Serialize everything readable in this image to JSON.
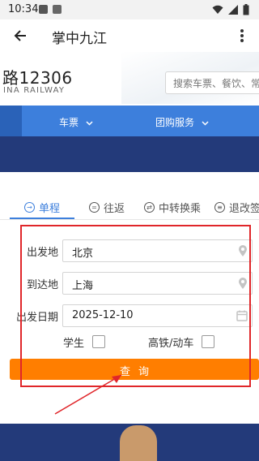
{
  "status_bar": {
    "time": "10:34",
    "icons": [
      "image-notification-icon",
      "text-notification-icon",
      "wifi-icon",
      "signal-icon",
      "battery-icon"
    ]
  },
  "app_bar": {
    "title": "掌中九江",
    "back_icon": "back-arrow-icon",
    "menu_icon": "overflow-menu-icon"
  },
  "site_header": {
    "logo_text": "路12306",
    "logo_subtext": "INA RAILWAY",
    "search_placeholder": "搜索车票、餐饮、常"
  },
  "nav": {
    "items": [
      {
        "label": "车票",
        "icon": "chevron-down-icon"
      },
      {
        "label": "团购服务",
        "icon": "chevron-down-icon"
      }
    ]
  },
  "tabs": [
    {
      "label": "单程",
      "active": true,
      "icon": "arrow-circle-icon"
    },
    {
      "label": "往返",
      "active": false,
      "icon": "equal-circle-icon"
    },
    {
      "label": "中转换乘",
      "active": false,
      "icon": "transfer-circle-icon"
    },
    {
      "label": "退改签",
      "active": false,
      "icon": "refund-circle-icon"
    }
  ],
  "form": {
    "from": {
      "label": "出发地",
      "value": "北京",
      "icon": "location-pin-icon"
    },
    "to": {
      "label": "到达地",
      "value": "上海",
      "icon": "location-pin-icon"
    },
    "date": {
      "label": "出发日期",
      "value": "2025-12-10",
      "icon": "calendar-icon"
    },
    "student": {
      "label": "学生",
      "checked": false
    },
    "high_speed": {
      "label": "高铁/动车",
      "checked": false
    },
    "query_label": "查询"
  },
  "colors": {
    "accent_blue": "#3d7fdc",
    "banner_navy": "#233a7a",
    "query_orange": "#ff7e00",
    "annotation_red": "#e0262a"
  }
}
